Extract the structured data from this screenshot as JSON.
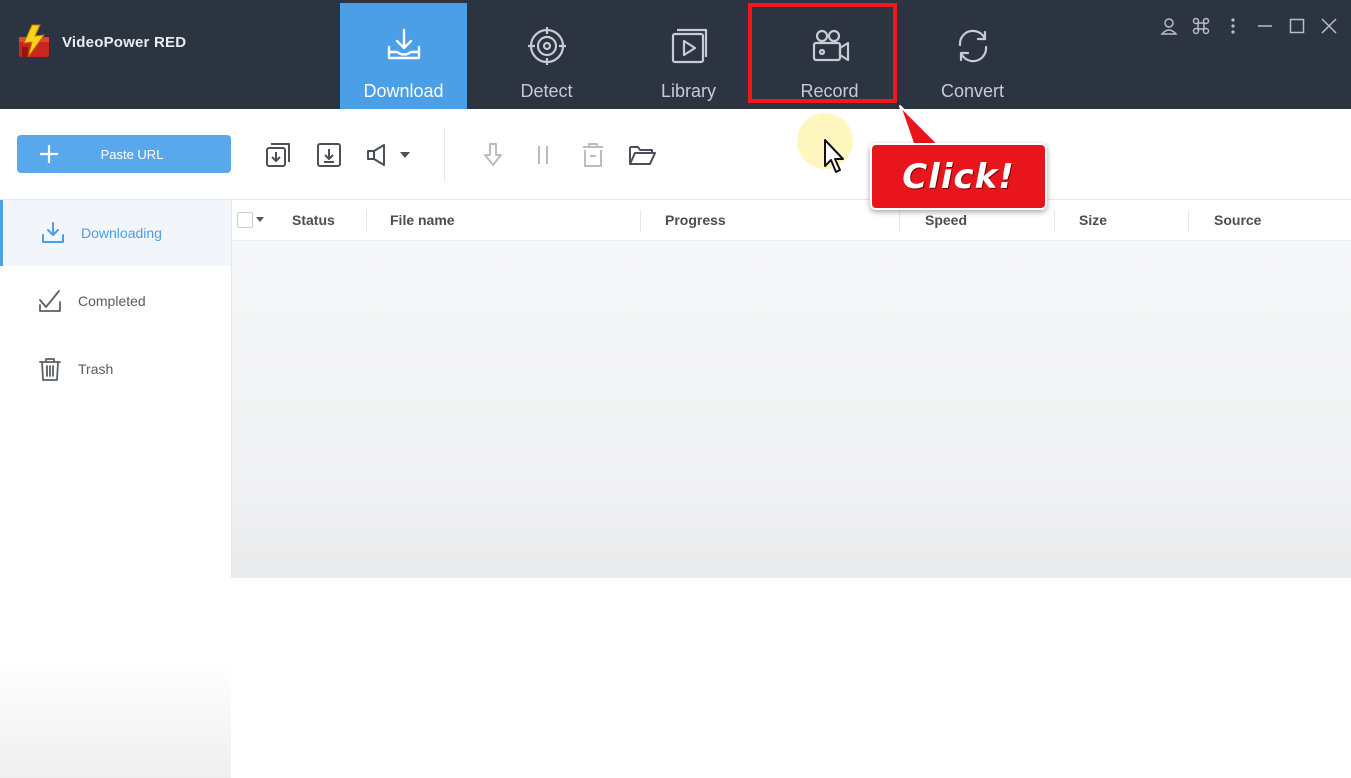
{
  "app": {
    "title": "VideoPower RED",
    "accent_color": "#4a9fe6",
    "header_bg": "#2c3442"
  },
  "nav": {
    "tabs": [
      {
        "label": "Download",
        "icon": "download-tray-icon",
        "active": true
      },
      {
        "label": "Detect",
        "icon": "target-icon"
      },
      {
        "label": "Library",
        "icon": "library-play-icon"
      },
      {
        "label": "Record",
        "icon": "video-camera-icon"
      },
      {
        "label": "Convert",
        "icon": "convert-cycle-icon"
      }
    ]
  },
  "window_controls": [
    "user-icon",
    "command-icon",
    "more-vertical-icon",
    "minimize-icon",
    "maximize-icon",
    "close-icon"
  ],
  "toolbar": {
    "paste_url_label": "Paste URL",
    "icons": [
      "batch-download-icon",
      "download-box-icon",
      "speaker-icon",
      "chevron-down-icon",
      "resume-icon",
      "pause-icon",
      "delete-icon",
      "open-folder-icon"
    ]
  },
  "sidebar": {
    "items": [
      {
        "label": "Downloading",
        "icon": "download-icon",
        "active": true
      },
      {
        "label": "Completed",
        "icon": "check-icon"
      },
      {
        "label": "Trash",
        "icon": "trash-icon"
      }
    ]
  },
  "table": {
    "columns": [
      "Status",
      "File name",
      "Progress",
      "Speed",
      "Size",
      "Source"
    ],
    "rows": []
  },
  "annotation": {
    "callout_text": "Click!",
    "highlight_color": "#f01818"
  }
}
